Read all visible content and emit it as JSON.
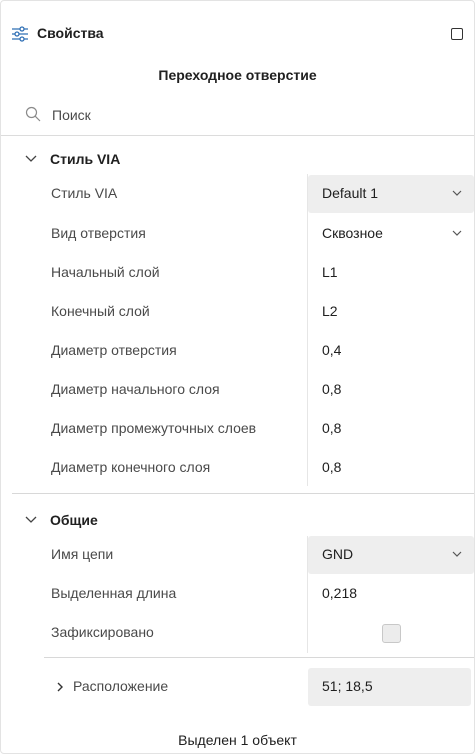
{
  "header": {
    "title": "Свойства",
    "icon": "sliders-icon"
  },
  "object_title": "Переходное отверстие",
  "search": {
    "placeholder": "Поиск"
  },
  "sections": {
    "via_style": {
      "title": "Стиль VIA",
      "rows": [
        {
          "label": "Стиль VIA",
          "value": "Default 1",
          "type": "dropdown"
        },
        {
          "label": "Вид отверстия",
          "value": "Сквозное",
          "type": "dropdown"
        },
        {
          "label": "Начальный слой",
          "value": "L1"
        },
        {
          "label": "Конечный слой",
          "value": "L2"
        },
        {
          "label": "Диаметр отверстия",
          "value": "0,4"
        },
        {
          "label": "Диаметр начального слоя",
          "value": "0,8"
        },
        {
          "label": "Диаметр промежуточных слоев",
          "value": "0,8"
        },
        {
          "label": "Диаметр конечного слоя",
          "value": "0,8"
        }
      ]
    },
    "general": {
      "title": "Общие",
      "rows": [
        {
          "label": "Имя цепи",
          "value": "GND",
          "type": "dropdown"
        },
        {
          "label": "Выделенная длина",
          "value": "0,218"
        },
        {
          "label": "Зафиксировано",
          "checked": false,
          "type": "checkbox"
        }
      ],
      "location": {
        "label": "Расположение",
        "value": "51; 18,5"
      }
    }
  },
  "status": "Выделен 1 объект",
  "colors": {
    "field_bg": "#eeeeee",
    "divider": "#d8d8d8",
    "text": "#202020",
    "label_text": "#4a4a4a"
  }
}
